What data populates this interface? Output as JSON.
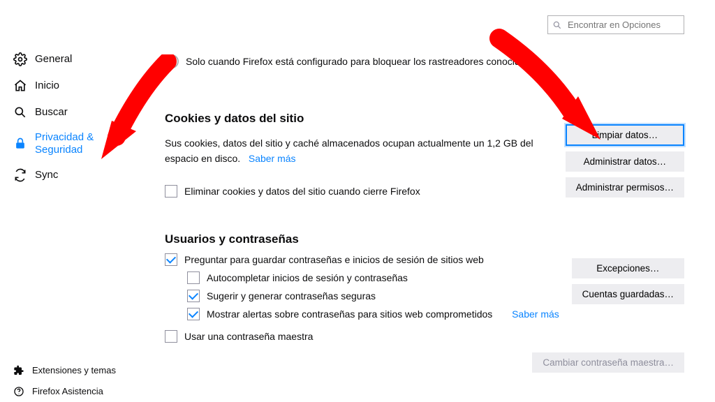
{
  "search": {
    "placeholder": "Encontrar en Opciones"
  },
  "sidebar": {
    "items": [
      {
        "label": "General"
      },
      {
        "label": "Inicio"
      },
      {
        "label": "Buscar"
      },
      {
        "label": "Privacidad & Seguridad"
      },
      {
        "label": "Sync"
      }
    ],
    "bottom": [
      {
        "label": "Extensiones y temas"
      },
      {
        "label": "Firefox Asistencia"
      }
    ]
  },
  "radio_row": {
    "label": "Solo cuando Firefox está configurado para bloquear los rastreadores conocidos"
  },
  "cookies": {
    "title": "Cookies y datos del sitio",
    "desc_prefix": "Sus cookies, datos del sitio y caché almacenados ocupan actualmente un 1,2 GB del espacio en disco.",
    "learn_more": "Saber más",
    "clear_on_close": "Eliminar cookies y datos del sitio cuando cierre Firefox",
    "buttons": {
      "clear": "Limpiar datos…",
      "manage_data": "Administrar datos…",
      "manage_permissions": "Administrar permisos…"
    }
  },
  "passwords": {
    "title": "Usuarios y contraseñas",
    "ask_save": "Preguntar para guardar contraseñas e inicios de sesión de sitios web",
    "autofill": "Autocompletar inicios de sesión y contraseñas",
    "suggest": "Sugerir y generar contraseñas seguras",
    "alerts": "Mostrar alertas sobre contraseñas para sitios web comprometidos",
    "alerts_learn_more": "Saber más",
    "master": "Usar una contraseña maestra",
    "buttons": {
      "exceptions": "Excepciones…",
      "saved": "Cuentas guardadas…",
      "change_master": "Cambiar contraseña maestra…"
    }
  }
}
